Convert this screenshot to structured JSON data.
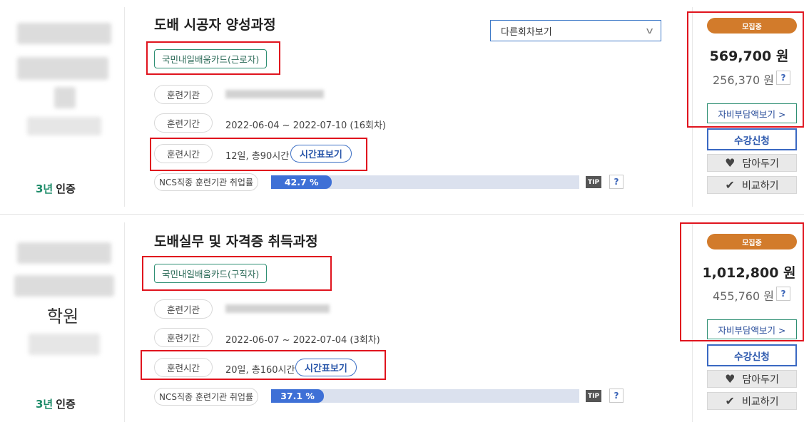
{
  "courses": [
    {
      "title": "도배 시공자 양성과정",
      "badge": "국민내일배움카드(근로자)",
      "labels": {
        "org": "훈련기관",
        "period": "훈련기간",
        "hours": "훈련시간",
        "ncs": "NCS직종 훈련기관 취업률"
      },
      "period": "2022-06-04 ~ 2022-07-10 (16회차)",
      "hours": "12일, 총90시간",
      "time_table_button": "시간표보기",
      "employment_rate_text": "42.7 %",
      "employment_rate": 42.7,
      "tip": "TIP",
      "help": "?",
      "other_rounds": "다른회차보기",
      "status": "모집중",
      "price": "569,700 원",
      "self_pay": "256,370 원",
      "self_pay_button": "자비부담액보기 >",
      "apply_button": "수강신청",
      "wishlist_button": "담아두기",
      "compare_button": "비교하기",
      "cert_num": "3년",
      "cert_label": "인증",
      "inst_visible_text": ""
    },
    {
      "title": "도배실무 및 자격증 취득과정",
      "badge": "국민내일배움카드(구직자)",
      "labels": {
        "org": "훈련기관",
        "period": "훈련기간",
        "hours": "훈련시간",
        "ncs": "NCS직종 훈련기관 취업률"
      },
      "period": "2022-06-07 ~ 2022-07-04 (3회차)",
      "hours": "20일, 총160시간",
      "time_table_button": "시간표보기",
      "employment_rate_text": "37.1 %",
      "employment_rate": 37.1,
      "tip": "TIP",
      "help": "?",
      "status": "모집중",
      "price": "1,012,800 원",
      "self_pay": "455,760 원",
      "self_pay_button": "자비부담액보기 >",
      "apply_button": "수강신청",
      "wishlist_button": "담아두기",
      "compare_button": "비교하기",
      "cert_num": "3년",
      "cert_label": "인증",
      "inst_visible_text": "학원"
    }
  ],
  "colors": {
    "status": "#d27b2b",
    "bar_fill": "#3e70d6",
    "bar_track": "#dbe1ee",
    "highlight_box": "#e0141e",
    "badge_border": "#2e8f73"
  },
  "icons": {
    "wishlist": "heart-icon",
    "compare": "check-icon",
    "select": "chevron-down-icon"
  }
}
